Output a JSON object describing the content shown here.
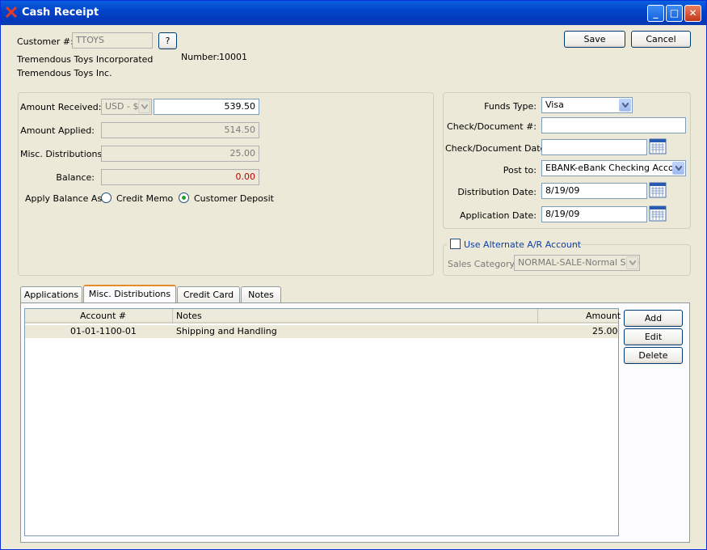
{
  "window": {
    "title": "Cash Receipt",
    "min_label": "_",
    "max_label": "□",
    "close_label": "✕"
  },
  "header": {
    "customer_label": "Customer #:",
    "customer_value": "TTOYS",
    "lookup_label": "?",
    "customer_name": "Tremendous Toys Incorporated",
    "customer_name2": "Tremendous Toys Inc.",
    "number_label": "Number:",
    "number_value": "10001",
    "save_label": "Save",
    "cancel_label": "Cancel"
  },
  "amounts": {
    "received_label": "Amount Received:",
    "currency": "USD - $",
    "received_value": "539.50",
    "applied_label": "Amount Applied:",
    "applied_value": "514.50",
    "misc_label": "Misc. Distributions:",
    "misc_value": "25.00",
    "balance_label": "Balance:",
    "balance_value": "0.00",
    "apply_balance_label": "Apply Balance As:",
    "credit_memo_label": "Credit Memo",
    "customer_deposit_label": "Customer Deposit"
  },
  "funds": {
    "funds_type_label": "Funds Type:",
    "funds_type_value": "Visa",
    "check_doc_label": "Check/Document #:",
    "check_doc_value": "",
    "check_date_label": "Check/Document Date:",
    "check_date_value": "",
    "post_to_label": "Post to:",
    "post_to_value": "EBANK-eBank Checking Account",
    "dist_date_label": "Distribution Date:",
    "dist_date_value": "8/19/09",
    "app_date_label": "Application Date:",
    "app_date_value": "8/19/09"
  },
  "alt_ar": {
    "use_alt_label": "Use Alternate A/R Account",
    "sales_category_label": "Sales Category:",
    "sales_category_value": "NORMAL-SALE-Normal Sale"
  },
  "tabs": [
    {
      "label": "Applications"
    },
    {
      "label": "Misc. Distributions"
    },
    {
      "label": "Credit Card"
    },
    {
      "label": "Notes"
    }
  ],
  "grid": {
    "columns": [
      "Account #",
      "Notes",
      "Amount"
    ],
    "rows": [
      {
        "account": "01-01-1100-01",
        "notes": "Shipping and Handling",
        "amount": "25.00"
      }
    ]
  },
  "side_buttons": {
    "add_label": "Add",
    "edit_label": "Edit",
    "delete_label": "Delete"
  },
  "colors": {
    "balance_text": "#c00000",
    "title_bar": "#0245c9",
    "link_blue": "#0b3ea8"
  }
}
